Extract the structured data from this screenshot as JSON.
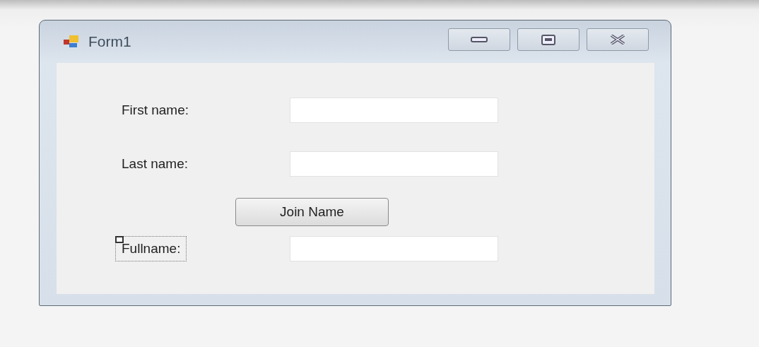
{
  "window": {
    "title": "Form1"
  },
  "title_buttons": [
    {
      "kind": "minimize"
    },
    {
      "kind": "maximize"
    },
    {
      "kind": "close"
    }
  ],
  "rows": [
    {
      "kind": "field",
      "label": "First name:",
      "selected": false
    },
    {
      "kind": "field",
      "label": "Last name:",
      "selected": false
    },
    {
      "kind": "button",
      "label": "Join Name"
    },
    {
      "kind": "field",
      "label": "Fullname:",
      "selected": true
    }
  ]
}
